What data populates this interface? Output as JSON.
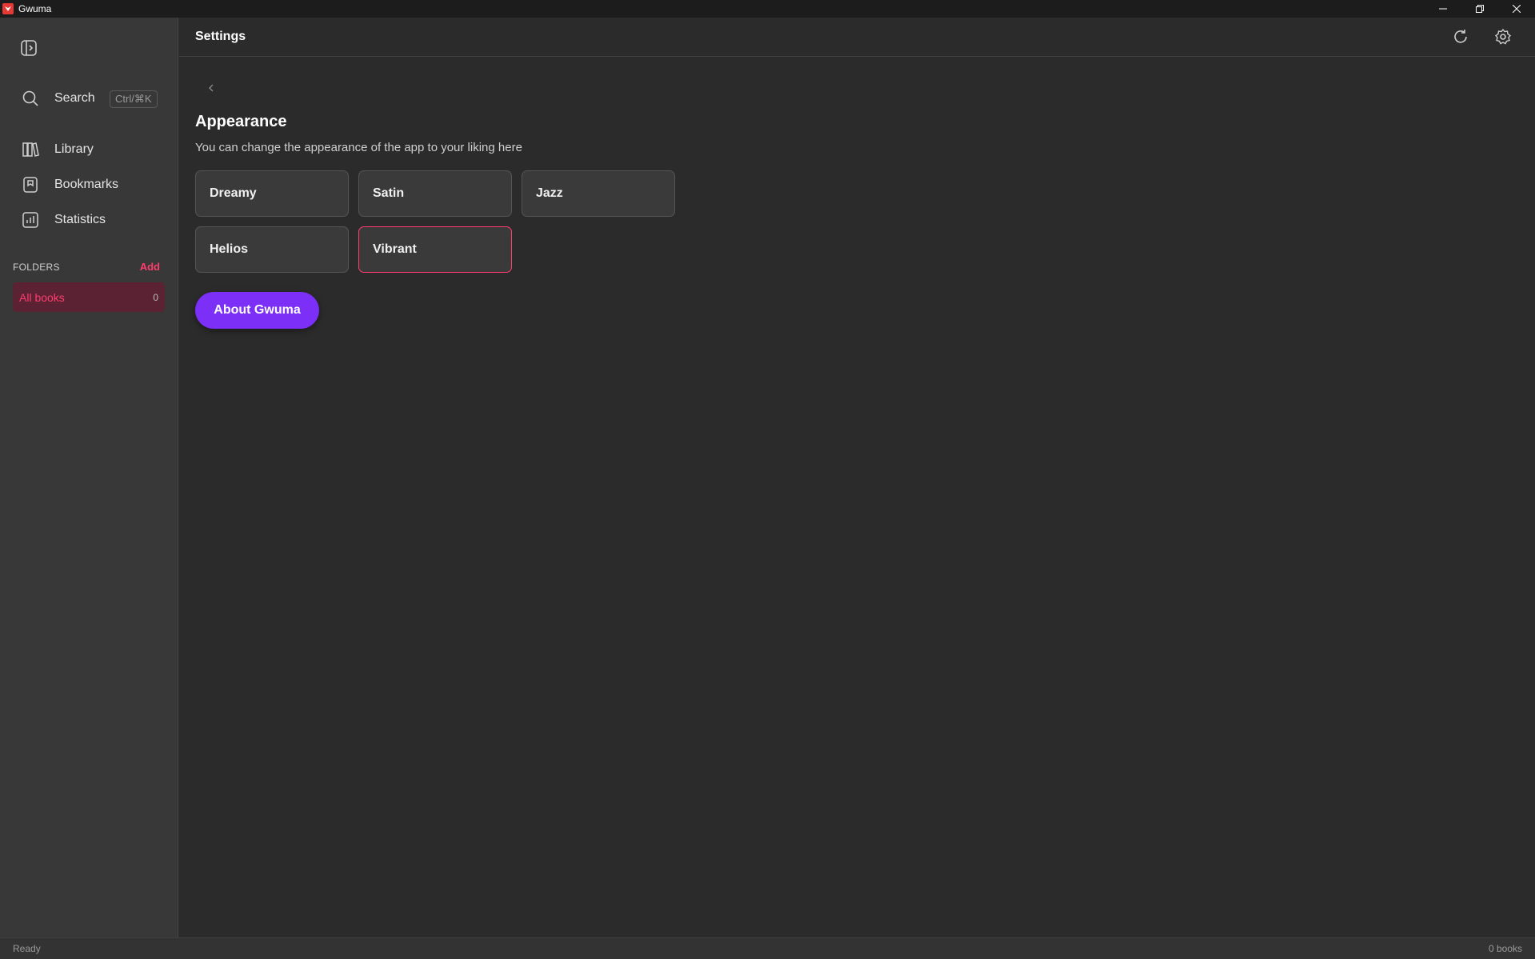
{
  "window": {
    "title": "Gwuma",
    "controls": {
      "minimize_icon": "minimize-icon",
      "restore_icon": "restore-icon",
      "close_icon": "close-icon"
    }
  },
  "sidebar": {
    "search": {
      "label": "Search",
      "shortcut": "Ctrl/⌘K",
      "icon": "search-icon"
    },
    "nav": [
      {
        "label": "Library",
        "icon": "library-icon"
      },
      {
        "label": "Bookmarks",
        "icon": "bookmark-icon"
      },
      {
        "label": "Statistics",
        "icon": "statistics-icon"
      }
    ],
    "folders": {
      "header": "FOLDERS",
      "add_label": "Add",
      "items": [
        {
          "name": "All books",
          "count": "0"
        }
      ]
    }
  },
  "topbar": {
    "title": "Settings",
    "refresh_icon": "refresh-icon",
    "settings_icon": "gear-icon"
  },
  "main": {
    "section_title": "Appearance",
    "section_desc": "You can change the appearance of the app to your liking here",
    "themes": [
      {
        "label": "Dreamy",
        "selected": false
      },
      {
        "label": "Satin",
        "selected": false
      },
      {
        "label": "Jazz",
        "selected": false
      },
      {
        "label": "Helios",
        "selected": false
      },
      {
        "label": "Vibrant",
        "selected": true
      }
    ],
    "about_button": "About Gwuma"
  },
  "statusbar": {
    "left": "Ready",
    "right": "0 books"
  },
  "colors": {
    "accent": "#ff3d6e",
    "primary_button": "#7b2ff7",
    "selected_folder_bg": "#5a2233"
  }
}
